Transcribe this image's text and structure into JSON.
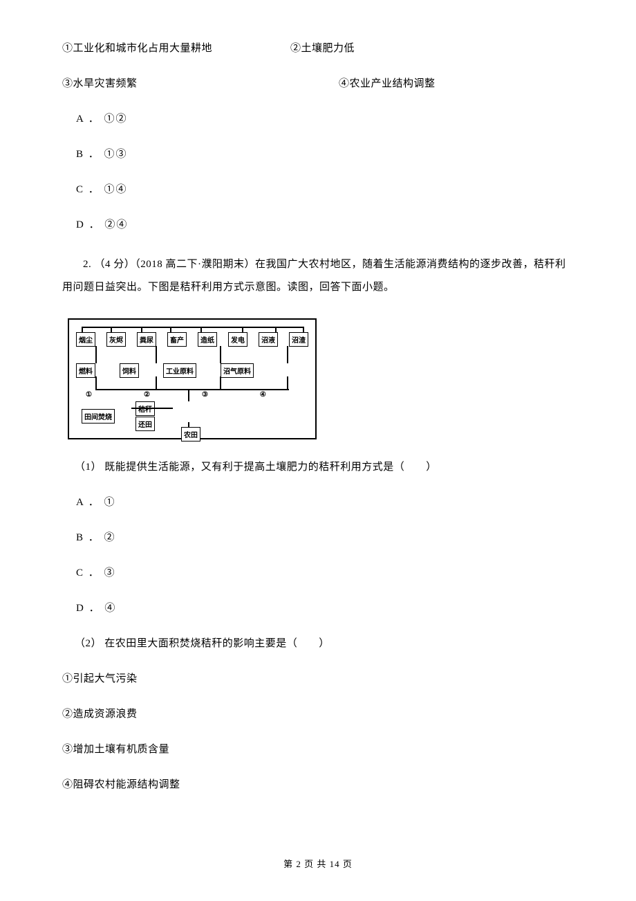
{
  "q1": {
    "stmt1_left": "①工业化和城市化占用大量耕地",
    "stmt1_right": "②土壤肥力低",
    "stmt3": "③水旱灾害频繁",
    "stmt4": "④农业产业结构调整",
    "optA": "A ． ①②",
    "optB": "B ． ①③",
    "optC": "C ． ①④",
    "optD": "D ． ②④"
  },
  "q2": {
    "stem": "2. （4 分）（2018 高二下·濮阳期末）在我国广大农村地区，随着生活能源消费结构的逐步改善，秸秆利用问题日益突出。下图是秸秆利用方式示意图。读图，回答下面小题。",
    "sub1": "（1） 既能提供生活能源，又有利于提高土壤肥力的秸秆利用方式是（　　）",
    "optA": "A ． ①",
    "optB": "B ． ②",
    "optC": "C ． ③",
    "optD": "D ． ④",
    "sub2": "（2） 在农田里大面积焚烧秸秆的影响主要是（　　）",
    "s1": "①引起大气污染",
    "s2": "②造成资源浪费",
    "s3": "③增加土壤有机质含量",
    "s4": "④阻碍农村能源结构调整"
  },
  "diagram": {
    "top": [
      "烟尘",
      "灰烬",
      "粪尿",
      "畜产",
      "造纸",
      "发电",
      "沼液",
      "沼渣"
    ],
    "mid": [
      "燃料",
      "饲料",
      "工业原料",
      "沼气原料"
    ],
    "labels": [
      "①",
      "②",
      "③",
      "④"
    ],
    "bottom1_a": "田间焚烧",
    "bottom1_b": "秸秆",
    "bottom1_c": "还田",
    "bottom2": "农田"
  },
  "footer": "第 2 页 共 14 页"
}
